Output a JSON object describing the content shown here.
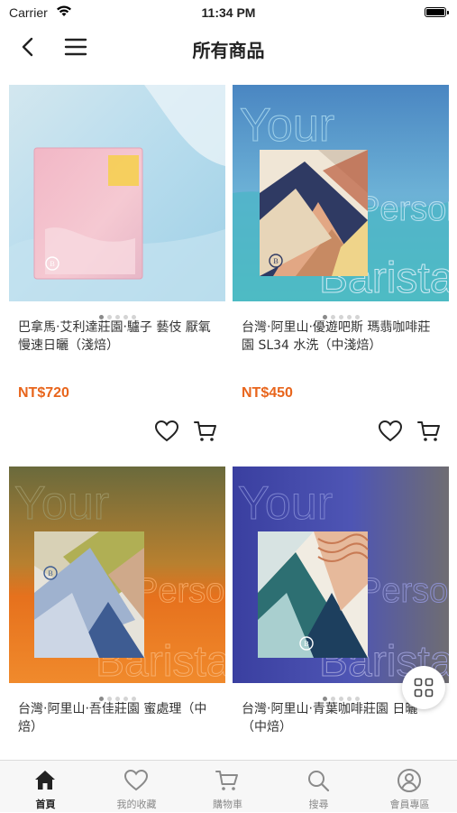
{
  "status_bar": {
    "carrier": "Carrier",
    "time": "11:34 PM"
  },
  "nav": {
    "title": "所有商品"
  },
  "products": [
    {
      "name": "巴拿馬‧艾利達莊園‧驢子 藝伎 厭氧慢速日曬（淺焙）",
      "price": "NT$720"
    },
    {
      "name": "台灣‧阿里山‧優遊吧斯 瑪翡咖啡莊園 SL34 水洗（中淺焙）",
      "price": "NT$450"
    },
    {
      "name": "台灣‧阿里山‧吾佳莊園 蜜處理（中焙）",
      "price": ""
    },
    {
      "name": "台灣‧阿里山‧青葉咖啡莊園 日曬（中焙）",
      "price": ""
    }
  ],
  "product_image_text": {
    "line1": "Your",
    "line2": "Personal",
    "line3": "Barista"
  },
  "tabs": [
    {
      "label": "首頁",
      "icon": "home-icon",
      "active": true
    },
    {
      "label": "我的收藏",
      "icon": "heart-icon",
      "active": false
    },
    {
      "label": "購物車",
      "icon": "cart-icon",
      "active": false
    },
    {
      "label": "搜尋",
      "icon": "search-icon",
      "active": false
    },
    {
      "label": "會員專區",
      "icon": "user-icon",
      "active": false
    }
  ],
  "colors": {
    "price": "#e8651c",
    "active_tab": "#222222",
    "inactive_tab": "#8a8a8a"
  }
}
